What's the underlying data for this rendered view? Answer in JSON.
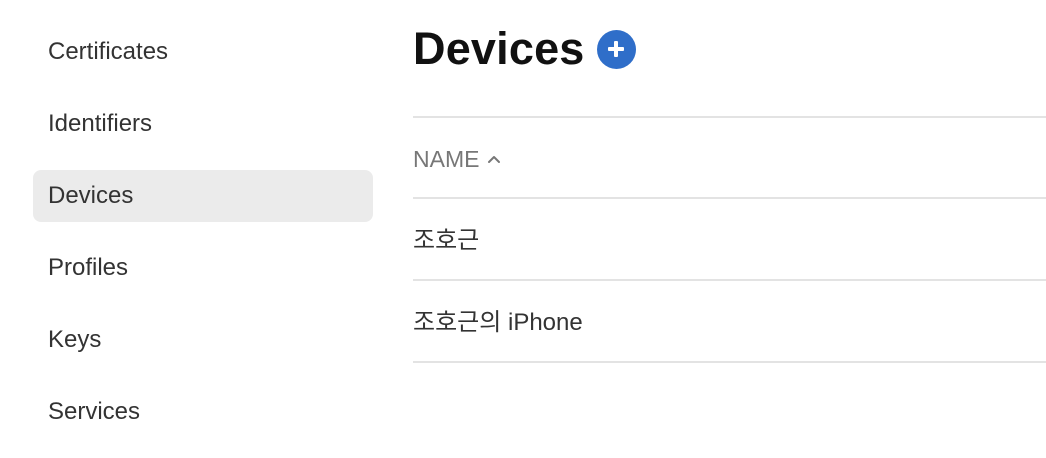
{
  "sidebar": {
    "items": [
      {
        "label": "Certificates"
      },
      {
        "label": "Identifiers"
      },
      {
        "label": "Devices"
      },
      {
        "label": "Profiles"
      },
      {
        "label": "Keys"
      },
      {
        "label": "Services"
      }
    ],
    "active_item": "Devices",
    "active_background": "#ebebeb"
  },
  "header": {
    "title": "Devices",
    "add_icon": "plus-circle-icon",
    "accent_color": "#2f6ec9"
  },
  "table": {
    "columns": [
      {
        "label": "NAME",
        "sort": "ascending",
        "sort_icon": "chevron-up-icon"
      }
    ],
    "rows": [
      {
        "name": "조호근"
      },
      {
        "name": "조호근의 iPhone"
      }
    ]
  }
}
